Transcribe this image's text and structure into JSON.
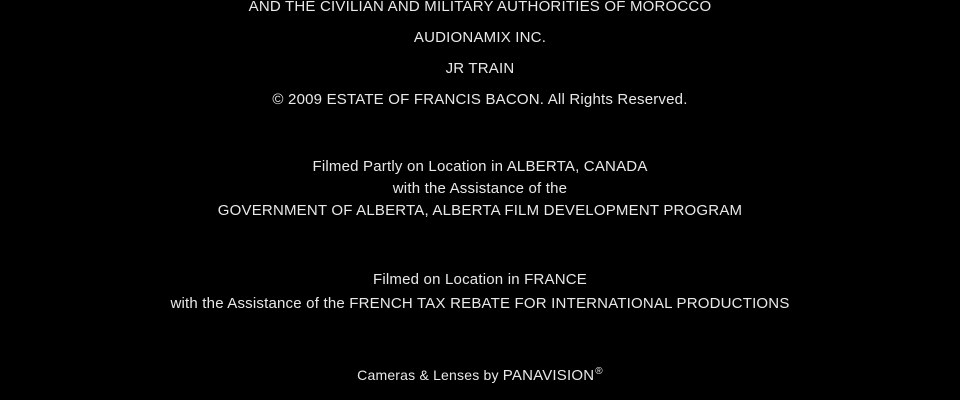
{
  "credits": {
    "line1": "AND THE CIVILIAN AND MILITARY AUTHORITIES OF MOROCCO",
    "line2": "AUDIONAMIX INC.",
    "line3": "JR TRAIN",
    "line4": "© 2009 ESTATE OF FRANCIS BACON.  All Rights Reserved.",
    "line5": "Filmed Partly on Location in ALBERTA, CANADA",
    "line6": "with the Assistance of the",
    "line7": "GOVERNMENT OF ALBERTA, ALBERTA FILM DEVELOPMENT PROGRAM",
    "line8": "Filmed on Location in FRANCE",
    "line9": "with the Assistance of the FRENCH TAX REBATE FOR INTERNATIONAL PRODUCTIONS",
    "line10_prefix": "Cameras & Lenses by ",
    "line10_brand": "PANAVISION",
    "line10_mark": "®"
  },
  "colors": {
    "background": "#000000",
    "text": "#e9e9e9"
  }
}
